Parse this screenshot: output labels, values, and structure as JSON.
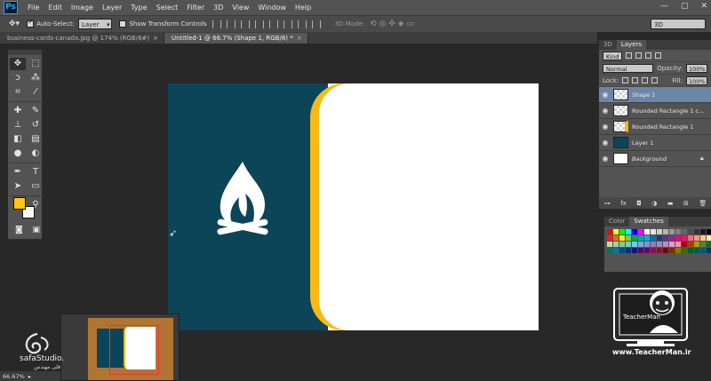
{
  "app": {
    "logo": "Ps"
  },
  "menu": [
    "File",
    "Edit",
    "Image",
    "Layer",
    "Type",
    "Select",
    "Filter",
    "3D",
    "View",
    "Window",
    "Help"
  ],
  "window_controls": [
    "—",
    "▢",
    "✕"
  ],
  "options_bar": {
    "auto_select_label": "Auto-Select:",
    "auto_select_value": "Layer",
    "show_transform_label": "Show Transform Controls",
    "mode_3d_label": "3D Mode:",
    "workspace": "3D"
  },
  "doc_tabs": [
    {
      "label": "business-cards-canada.jpg @ 174% (RGB/8#)",
      "close": "×"
    },
    {
      "label": "Untitled-1 @ 66.7% (Shape 1, RGB/8) *",
      "close": "×"
    }
  ],
  "tools": {
    "icons": [
      "move-icon",
      "marquee-icon",
      "lasso-icon",
      "quick-select-icon",
      "crop-icon",
      "eyedropper-icon",
      "healing-icon",
      "brush-icon",
      "stamp-icon",
      "history-brush-icon",
      "eraser-icon",
      "gradient-icon",
      "blur-icon",
      "dodge-icon",
      "pen-icon",
      "type-icon",
      "path-select-icon",
      "shape-icon",
      "hand-icon",
      "zoom-icon"
    ],
    "foreground_color": "#ffc414",
    "background_color": "#ffffff"
  },
  "canvas": {
    "teal": "#0c4558",
    "gold": "#f8b912",
    "white": "#ffffff"
  },
  "layers_panel": {
    "tabs": [
      "3D",
      "Layers"
    ],
    "kind_label": "Kind",
    "blend_mode": "Normal",
    "opacity_label": "Opacity:",
    "opacity_value": "100%",
    "lock_label": "Lock:",
    "fill_label": "Fill:",
    "fill_value": "100%",
    "layers": [
      {
        "name": "Shape 1",
        "selected": true
      },
      {
        "name": "Rounded Rectangle 1 c...",
        "selected": false
      },
      {
        "name": "Rounded Rectangle 1",
        "selected": false
      },
      {
        "name": "Layer 1",
        "selected": false
      },
      {
        "name": "Background",
        "selected": false,
        "locked": true
      }
    ],
    "footer_icons": [
      "link-icon",
      "fx-icon",
      "mask-icon",
      "adjustment-icon",
      "group-icon",
      "new-layer-icon",
      "trash-icon"
    ],
    "footer_fx": "fx"
  },
  "swatches_panel": {
    "tabs": [
      "Color",
      "Swatches"
    ],
    "colors": [
      "#ff0000",
      "#ffff00",
      "#00ff00",
      "#00ffff",
      "#0000ff",
      "#ff00ff",
      "#ffffff",
      "#e6e6e6",
      "#cccccc",
      "#b3b3b3",
      "#999999",
      "#808080",
      "#666666",
      "#4d4d4d",
      "#333333",
      "#1a1a1a",
      "#000000",
      "#ee1d24",
      "#f36523",
      "#fff100",
      "#8dc63f",
      "#00a651",
      "#00a99d",
      "#00aeef",
      "#0072bc",
      "#2e3192",
      "#662d91",
      "#92278f",
      "#ec008c",
      "#ed145b",
      "#f26d7d",
      "#f69679",
      "#fdc689",
      "#fff799",
      "#c4df9b",
      "#a3d39c",
      "#82ca9c",
      "#7accc8",
      "#6dcff6",
      "#7da7d9",
      "#8393ca",
      "#8781bd",
      "#a187be",
      "#bc8cbf",
      "#f49ac1",
      "#f5989d",
      "#9e0b0f",
      "#a0410d",
      "#aba000",
      "#598527",
      "#007236",
      "#00746b",
      "#0076a3",
      "#004a80",
      "#003471",
      "#1b1464",
      "#440e62",
      "#630460",
      "#9e005d",
      "#9e0039",
      "#790000",
      "#7b2e00",
      "#827b00",
      "#406618",
      "#005e20",
      "#005952",
      "#005b7f",
      "#003663"
    ]
  },
  "watermark": {
    "url": "www.TeacherMan.ir",
    "badge_text": "TeacherMan"
  },
  "studio_mark": {
    "name": "safaStudio.",
    "subtitle": "قلی مهندس"
  },
  "status": {
    "zoom": "66.67%"
  }
}
